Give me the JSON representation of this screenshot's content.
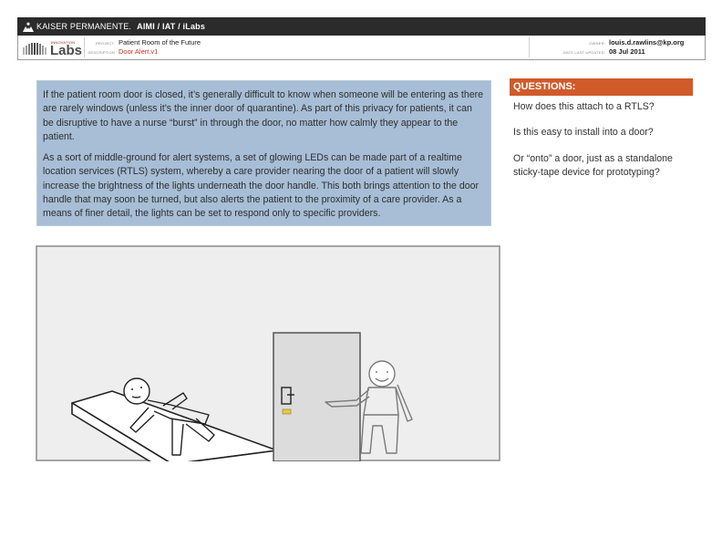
{
  "header": {
    "brand": "KAISER PERMANENTE.",
    "org_path": "AIMI / IAT / iLabs",
    "labs_tag": "INNOVATION",
    "labs_name": "Labs",
    "project_label": "PROJECT:",
    "project": "Patient Room of the Future",
    "description_label": "DESCRIPTION",
    "description": "Door Alert.v1",
    "owner_label": "OWNER:",
    "owner": "louis.d.rawlins@kp.org",
    "updated_label": "DATE LAST UPDATED:",
    "updated": "08 Jul 2011"
  },
  "body": {
    "paragraph1": "If the patient room door is closed, it’s generally difficult to know when someone will be entering as there are rarely windows (unless it’s the inner door of quarantine). As part of this privacy for patients, it can be disruptive to have a nurse “burst” in through the door, no matter how calmly they appear to the patient.",
    "paragraph2": "As a sort of middle-ground for alert systems, a set of glowing LEDs can be made part of a realtime location services (RTLS) system, whereby a care provider nearing the door of a patient will slowly increase the brightness of the lights underneath the door handle. This both brings attention to the door handle that may soon be turned, but also alerts the patient to the proximity of a care provider. As a means of finer detail, the lights can be set to respond only to specific providers."
  },
  "questions": {
    "heading": "QUESTIONS:",
    "items": [
      "How does this attach to a RTLS?",
      "Is this easy to install into a door?",
      "Or “onto” a door, just as a standalone sticky-tape device for prototyping?"
    ]
  },
  "colors": {
    "topbar": "#2b2b2b",
    "description_bg": "#a7bed6",
    "questions_accent": "#d05a2a",
    "led": "#e6c94a",
    "sketch_bg": "#eeeeee"
  }
}
